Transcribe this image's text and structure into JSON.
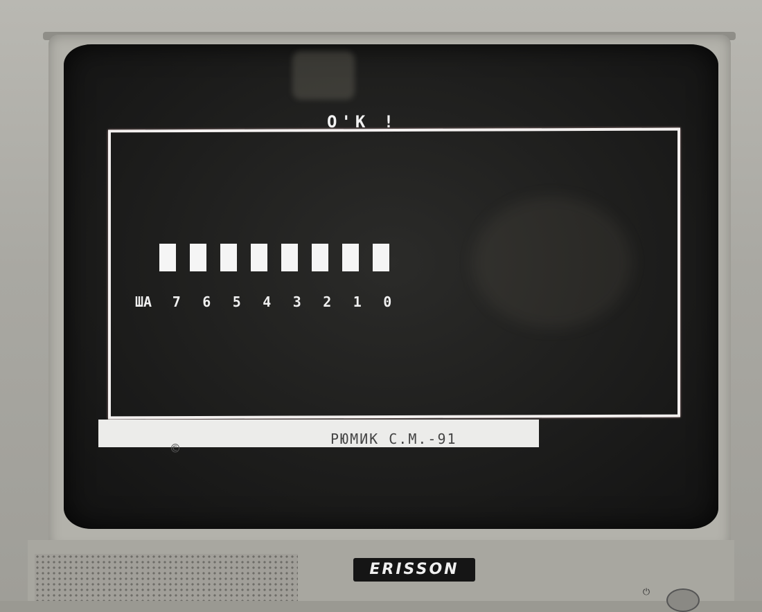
{
  "screen": {
    "title": "O'K !",
    "bits": {
      "leds": [
        1,
        1,
        1,
        1,
        1,
        1,
        1,
        1
      ],
      "labels": [
        "ША",
        "7",
        "6",
        "5",
        "4",
        "3",
        "2",
        "1",
        "0"
      ]
    },
    "footer": {
      "copyright_symbol": "©",
      "credit": "РЮМИК С.М.-91"
    }
  },
  "tv": {
    "brand": "ERISSON"
  },
  "colors": {
    "screen_bg": "#1c1c1b",
    "text": "#f2f2f2",
    "footer_bar": "#ececea"
  }
}
